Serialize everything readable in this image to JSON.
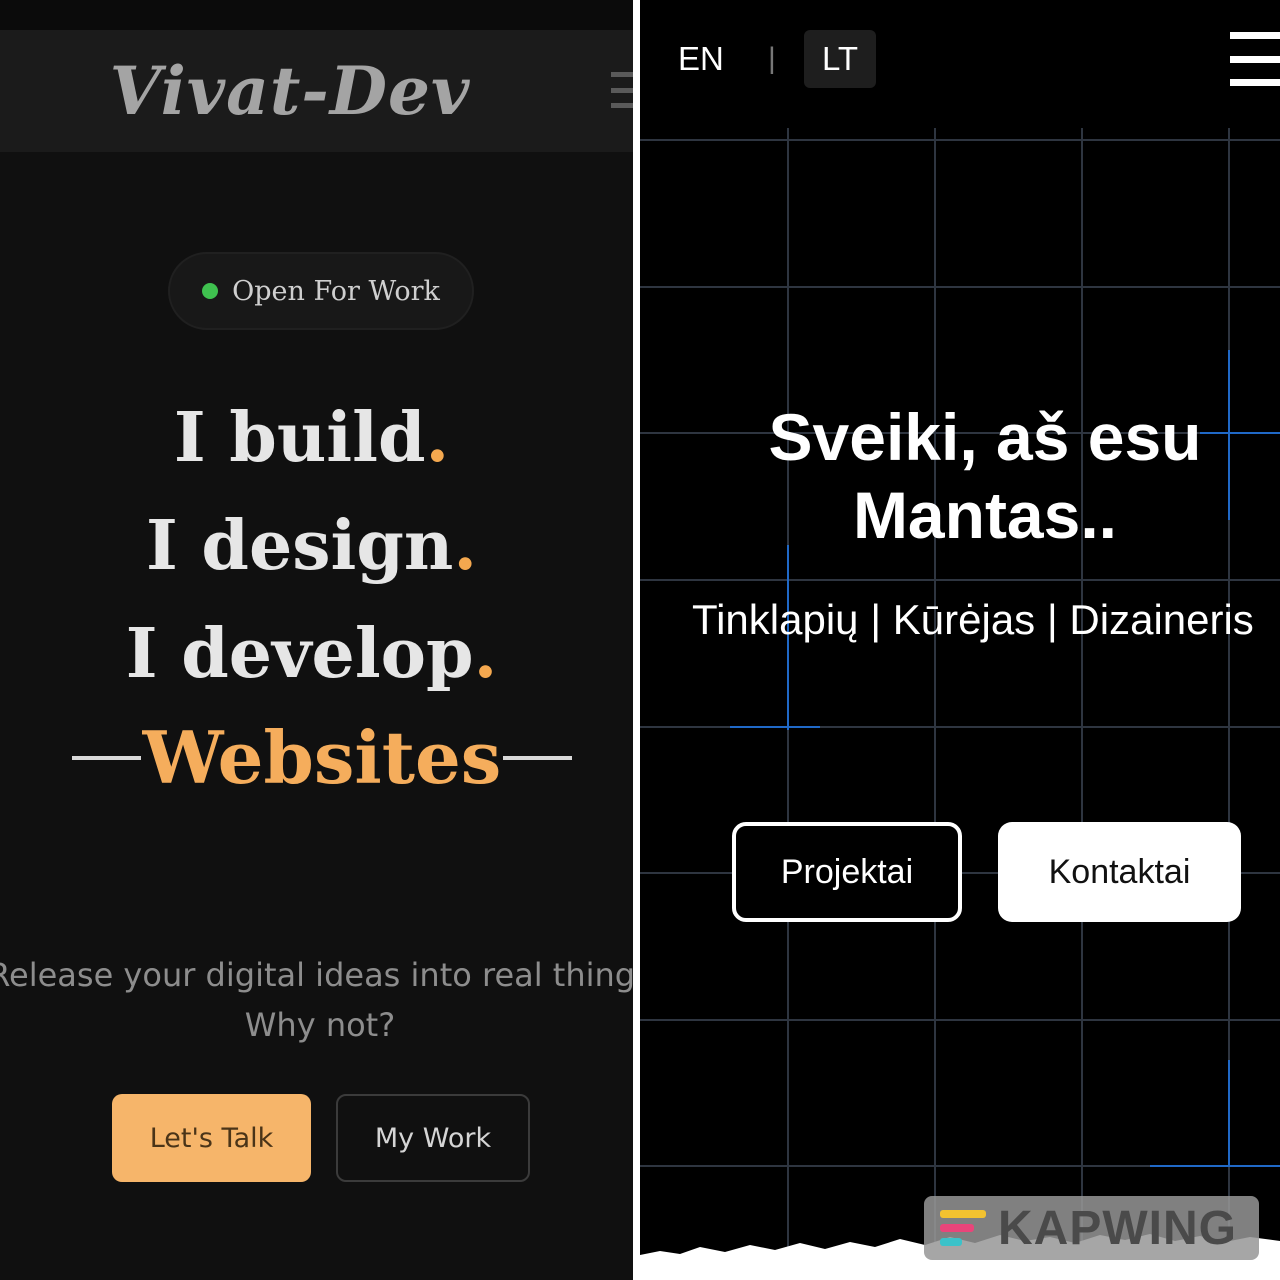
{
  "left_site": {
    "logo": "Vivat-Dev",
    "badge": "Open For Work",
    "headline": {
      "line1": "I build",
      "line2": "I design",
      "line3": "I develop",
      "dot": ".",
      "highlight": "Websites"
    },
    "tagline": {
      "line1": "Release your digital ideas into real things",
      "line2": "Why not?"
    },
    "buttons": {
      "primary": "Let's Talk",
      "secondary": "My Work"
    },
    "colors": {
      "accent": "#f4a84f",
      "background": "#101010",
      "status_dot": "#3fc14f"
    }
  },
  "right_site": {
    "language": {
      "en": "EN",
      "separator": "|",
      "lt": "LT"
    },
    "title": {
      "line1": "Sveiki, aš esu",
      "line2": "Mantas.."
    },
    "subtitle": "Tinklapių | Kūrėjas | Dizaineris",
    "buttons": {
      "projects": "Projektai",
      "contacts": "Kontaktai"
    },
    "colors": {
      "background": "#000000",
      "grid": "#2e3540",
      "grid_glow": "#1f6fd6"
    }
  },
  "watermark": {
    "text": "KAPWING"
  }
}
